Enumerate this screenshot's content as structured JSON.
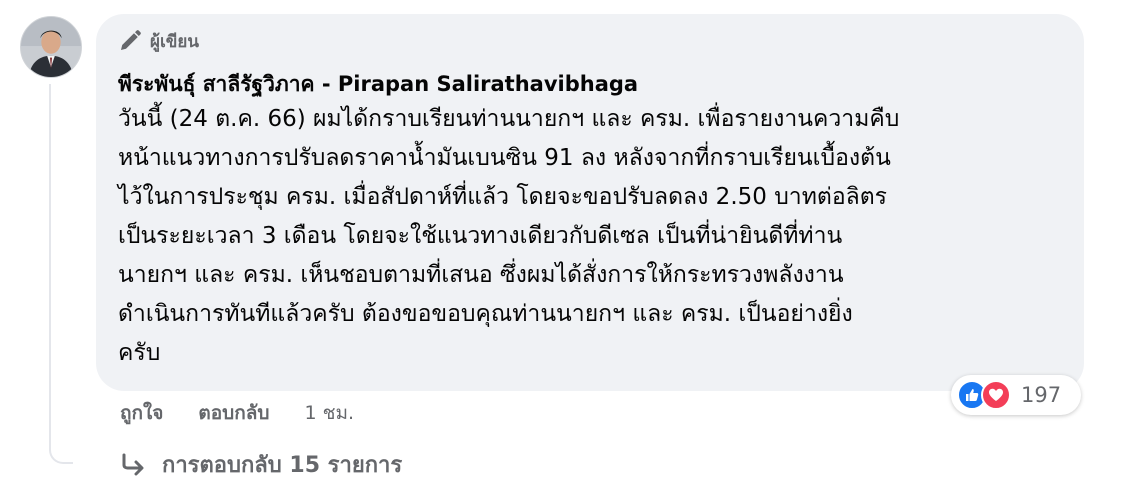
{
  "comment": {
    "badge_label": "ผู้เขียน",
    "author": "พีระพันธุ์ สาลีรัฐวิภาค - Pirapan Salirathavibhaga",
    "lines": [
      "วันนี้ (24 ต.ค. 66) ผมได้กราบเรียนท่านนายกฯ และ ครม. เพื่อรายงานความคืบ",
      "หน้าแนวทางการปรับลดราคาน้ำมันเบนซิน 91 ลง หลังจากที่กราบเรียนเบื้องต้น",
      "ไว้ในการประชุม ครม. เมื่อสัปดาห์ที่แล้ว โดยจะขอปรับลดลง 2.50 บาทต่อลิตร",
      "เป็นระยะเวลา 3 เดือน โดยจะใช้แนวทางเดียวกับดีเซล เป็นที่น่ายินดีที่ท่าน",
      "นายกฯ และ ครม. เห็นชอบตามที่เสนอ ซึ่งผมได้สั่งการให้กระทรวงพลังงาน",
      "ดำเนินการทันทีแล้วครับ ต้องขอขอบคุณท่านนายกฯ และ ครม. เป็นอย่างยิ่ง",
      "ครับ"
    ]
  },
  "reactions": {
    "icons": [
      "like-icon",
      "love-icon"
    ],
    "count": "197",
    "like_color": "#1877f2",
    "love_color": "#f33e58"
  },
  "actions": {
    "like_label": "ถูกใจ",
    "reply_label": "ตอบกลับ",
    "time": "1 ชม."
  },
  "replies": {
    "label": "การตอบกลับ 15 รายการ"
  }
}
